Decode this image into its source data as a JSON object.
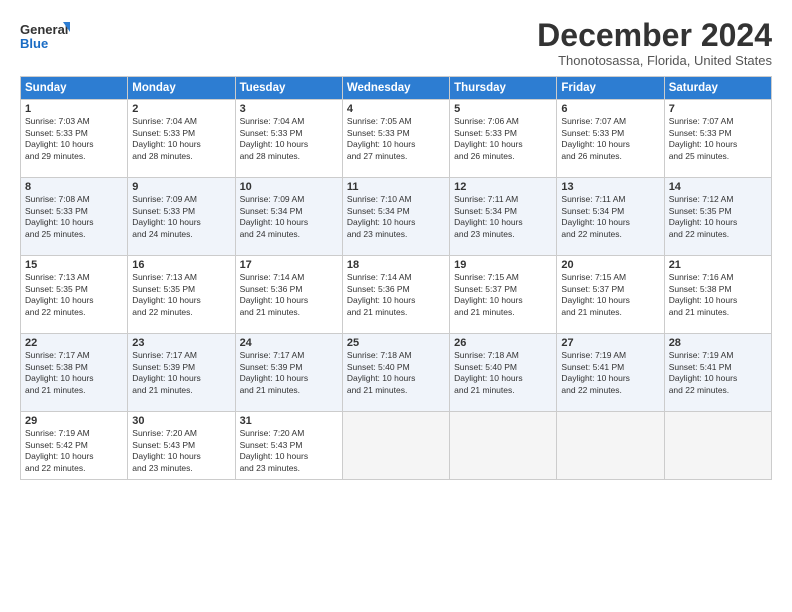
{
  "logo": {
    "line1": "General",
    "line2": "Blue"
  },
  "title": "December 2024",
  "location": "Thonotosassa, Florida, United States",
  "days_of_week": [
    "Sunday",
    "Monday",
    "Tuesday",
    "Wednesday",
    "Thursday",
    "Friday",
    "Saturday"
  ],
  "weeks": [
    [
      {
        "day": "1",
        "text": "Sunrise: 7:03 AM\nSunset: 5:33 PM\nDaylight: 10 hours\nand 29 minutes."
      },
      {
        "day": "2",
        "text": "Sunrise: 7:04 AM\nSunset: 5:33 PM\nDaylight: 10 hours\nand 28 minutes."
      },
      {
        "day": "3",
        "text": "Sunrise: 7:04 AM\nSunset: 5:33 PM\nDaylight: 10 hours\nand 28 minutes."
      },
      {
        "day": "4",
        "text": "Sunrise: 7:05 AM\nSunset: 5:33 PM\nDaylight: 10 hours\nand 27 minutes."
      },
      {
        "day": "5",
        "text": "Sunrise: 7:06 AM\nSunset: 5:33 PM\nDaylight: 10 hours\nand 26 minutes."
      },
      {
        "day": "6",
        "text": "Sunrise: 7:07 AM\nSunset: 5:33 PM\nDaylight: 10 hours\nand 26 minutes."
      },
      {
        "day": "7",
        "text": "Sunrise: 7:07 AM\nSunset: 5:33 PM\nDaylight: 10 hours\nand 25 minutes."
      }
    ],
    [
      {
        "day": "8",
        "text": "Sunrise: 7:08 AM\nSunset: 5:33 PM\nDaylight: 10 hours\nand 25 minutes."
      },
      {
        "day": "9",
        "text": "Sunrise: 7:09 AM\nSunset: 5:33 PM\nDaylight: 10 hours\nand 24 minutes."
      },
      {
        "day": "10",
        "text": "Sunrise: 7:09 AM\nSunset: 5:34 PM\nDaylight: 10 hours\nand 24 minutes."
      },
      {
        "day": "11",
        "text": "Sunrise: 7:10 AM\nSunset: 5:34 PM\nDaylight: 10 hours\nand 23 minutes."
      },
      {
        "day": "12",
        "text": "Sunrise: 7:11 AM\nSunset: 5:34 PM\nDaylight: 10 hours\nand 23 minutes."
      },
      {
        "day": "13",
        "text": "Sunrise: 7:11 AM\nSunset: 5:34 PM\nDaylight: 10 hours\nand 22 minutes."
      },
      {
        "day": "14",
        "text": "Sunrise: 7:12 AM\nSunset: 5:35 PM\nDaylight: 10 hours\nand 22 minutes."
      }
    ],
    [
      {
        "day": "15",
        "text": "Sunrise: 7:13 AM\nSunset: 5:35 PM\nDaylight: 10 hours\nand 22 minutes."
      },
      {
        "day": "16",
        "text": "Sunrise: 7:13 AM\nSunset: 5:35 PM\nDaylight: 10 hours\nand 22 minutes."
      },
      {
        "day": "17",
        "text": "Sunrise: 7:14 AM\nSunset: 5:36 PM\nDaylight: 10 hours\nand 21 minutes."
      },
      {
        "day": "18",
        "text": "Sunrise: 7:14 AM\nSunset: 5:36 PM\nDaylight: 10 hours\nand 21 minutes."
      },
      {
        "day": "19",
        "text": "Sunrise: 7:15 AM\nSunset: 5:37 PM\nDaylight: 10 hours\nand 21 minutes."
      },
      {
        "day": "20",
        "text": "Sunrise: 7:15 AM\nSunset: 5:37 PM\nDaylight: 10 hours\nand 21 minutes."
      },
      {
        "day": "21",
        "text": "Sunrise: 7:16 AM\nSunset: 5:38 PM\nDaylight: 10 hours\nand 21 minutes."
      }
    ],
    [
      {
        "day": "22",
        "text": "Sunrise: 7:17 AM\nSunset: 5:38 PM\nDaylight: 10 hours\nand 21 minutes."
      },
      {
        "day": "23",
        "text": "Sunrise: 7:17 AM\nSunset: 5:39 PM\nDaylight: 10 hours\nand 21 minutes."
      },
      {
        "day": "24",
        "text": "Sunrise: 7:17 AM\nSunset: 5:39 PM\nDaylight: 10 hours\nand 21 minutes."
      },
      {
        "day": "25",
        "text": "Sunrise: 7:18 AM\nSunset: 5:40 PM\nDaylight: 10 hours\nand 21 minutes."
      },
      {
        "day": "26",
        "text": "Sunrise: 7:18 AM\nSunset: 5:40 PM\nDaylight: 10 hours\nand 21 minutes."
      },
      {
        "day": "27",
        "text": "Sunrise: 7:19 AM\nSunset: 5:41 PM\nDaylight: 10 hours\nand 22 minutes."
      },
      {
        "day": "28",
        "text": "Sunrise: 7:19 AM\nSunset: 5:41 PM\nDaylight: 10 hours\nand 22 minutes."
      }
    ],
    [
      {
        "day": "29",
        "text": "Sunrise: 7:19 AM\nSunset: 5:42 PM\nDaylight: 10 hours\nand 22 minutes."
      },
      {
        "day": "30",
        "text": "Sunrise: 7:20 AM\nSunset: 5:43 PM\nDaylight: 10 hours\nand 23 minutes."
      },
      {
        "day": "31",
        "text": "Sunrise: 7:20 AM\nSunset: 5:43 PM\nDaylight: 10 hours\nand 23 minutes."
      },
      {
        "day": "",
        "text": ""
      },
      {
        "day": "",
        "text": ""
      },
      {
        "day": "",
        "text": ""
      },
      {
        "day": "",
        "text": ""
      }
    ]
  ]
}
